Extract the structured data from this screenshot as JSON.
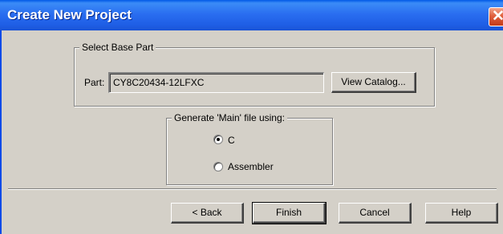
{
  "window": {
    "title": "Create New Project"
  },
  "base_part": {
    "legend": "Select Base Part",
    "part_label": "Part:",
    "part_value": "CY8C20434-12LFXC",
    "view_catalog_label": "View Catalog..."
  },
  "main_file": {
    "legend": "Generate 'Main' file using:",
    "options": [
      {
        "label": "C",
        "selected": true
      },
      {
        "label": "Assembler",
        "selected": false
      }
    ]
  },
  "buttons": {
    "back": "< Back",
    "finish": "Finish",
    "cancel": "Cancel",
    "help": "Help"
  },
  "icons": {
    "close": "close-icon"
  },
  "colors": {
    "titlebar": "#2a6ef0",
    "face": "#d4d0c8",
    "close": "#e0603e"
  }
}
